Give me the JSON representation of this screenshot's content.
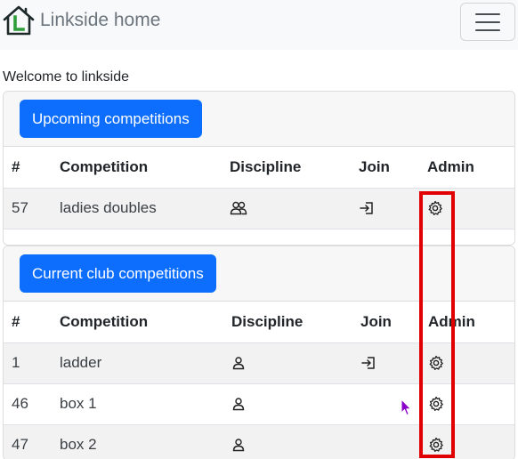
{
  "navbar": {
    "brand_text": "Linkside home",
    "logo_icon": "house-icon",
    "menu_icon": "hamburger-menu-icon"
  },
  "welcome_text": "Welcome to linkside",
  "upcoming": {
    "button_label": "Upcoming competitions",
    "headers": [
      "#",
      "Competition",
      "Discipline",
      "Join",
      "Admin"
    ],
    "rows": [
      {
        "id": "57",
        "name": "ladies doubles",
        "discipline_icon": "people-icon",
        "join_icon": "sign-in-icon",
        "admin_icon": "gear-icon"
      }
    ]
  },
  "current": {
    "button_label": "Current club competitions",
    "headers": [
      "#",
      "Competition",
      "Discipline",
      "Join",
      "Admin"
    ],
    "rows": [
      {
        "id": "1",
        "name": "ladder",
        "discipline_icon": "person-icon",
        "join_icon": "sign-in-icon",
        "admin_icon": "gear-icon"
      },
      {
        "id": "46",
        "name": "box 1",
        "discipline_icon": "person-icon",
        "join_icon": "",
        "admin_icon": "gear-icon"
      },
      {
        "id": "47",
        "name": "box 2",
        "discipline_icon": "person-icon",
        "join_icon": "",
        "admin_icon": "gear-icon"
      }
    ]
  },
  "colors": {
    "primary": "#0d6efd",
    "highlight": "#e00000",
    "navbar_bg": "#f8f9fa",
    "cursor": "#8a00c8"
  }
}
